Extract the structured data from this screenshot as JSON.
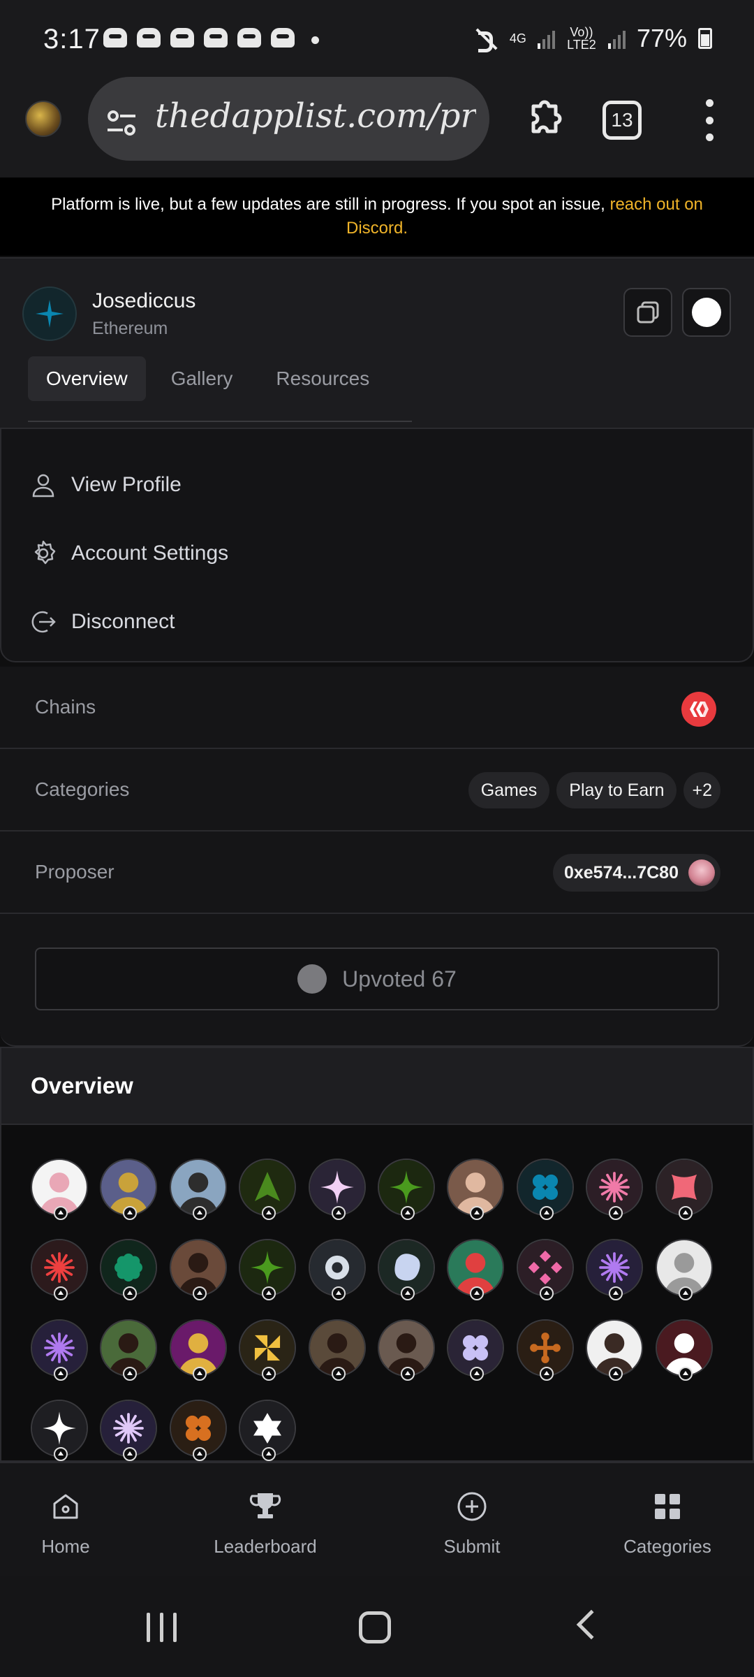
{
  "status_bar": {
    "time": "3:17",
    "network": "4G",
    "volte": "Vo)) LTE2",
    "battery": "77%"
  },
  "browser": {
    "url": "thedapplist.com/projec",
    "tab_count": "13"
  },
  "banner": {
    "text": "Platform is live, but a few updates are still in progress. If you spot an issue, ",
    "link": "reach out on Discord."
  },
  "project": {
    "name": "Josediccus",
    "chain": "Ethereum",
    "tabs": [
      "Overview",
      "Gallery",
      "Resources"
    ]
  },
  "user_menu": {
    "items": [
      "View Profile",
      "Account Settings",
      "Disconnect"
    ]
  },
  "details": {
    "chains_label": "Chains",
    "categories_label": "Categories",
    "categories": [
      "Games",
      "Play to Earn",
      "+2"
    ],
    "proposer_label": "Proposer",
    "proposer_address": "0xe574...7C80"
  },
  "upvote": {
    "label": "Upvoted 67"
  },
  "overview": {
    "title": "Overview",
    "voters": [
      {
        "bg": "#f4f4f4",
        "fg": "#e9a7b6",
        "icon": "photo"
      },
      {
        "bg": "#5b5f8a",
        "fg": "#c9a23a",
        "icon": "photo"
      },
      {
        "bg": "#8aa5c0",
        "fg": "#2d2d2d",
        "icon": "photo"
      },
      {
        "bg": "#1f2a10",
        "fg": "#4a8a1e",
        "icon": "tri"
      },
      {
        "bg": "#2a2436",
        "fg": "#f2d0f5",
        "icon": "star4"
      },
      {
        "bg": "#1c2810",
        "fg": "#4a9a1e",
        "icon": "star4"
      },
      {
        "bg": "#7a5a4a",
        "fg": "#e0b8a0",
        "icon": "photo"
      },
      {
        "bg": "#12262c",
        "fg": "#0a86b0",
        "icon": "clover"
      },
      {
        "bg": "#2c1e26",
        "fg": "#f07aa8",
        "icon": "burst"
      },
      {
        "bg": "#2c2226",
        "fg": "#f06878",
        "icon": "square"
      },
      {
        "bg": "#2c1a1c",
        "fg": "#ee4040",
        "icon": "burst"
      },
      {
        "bg": "#10261c",
        "fg": "#15966a",
        "icon": "flower"
      },
      {
        "bg": "#6a4a3a",
        "fg": "#2a1a14",
        "icon": "photo"
      },
      {
        "bg": "#1c2810",
        "fg": "#4a9a1e",
        "icon": "star4"
      },
      {
        "bg": "#262a30",
        "fg": "#d8dfe8",
        "icon": "ring"
      },
      {
        "bg": "#1c2824",
        "fg": "#c8d4f0",
        "icon": "blob"
      },
      {
        "bg": "#2a7a5a",
        "fg": "#e04040",
        "icon": "photo"
      },
      {
        "bg": "#2c1e26",
        "fg": "#f06aa8",
        "icon": "diamonds"
      },
      {
        "bg": "#26203a",
        "fg": "#b07af0",
        "icon": "burst"
      },
      {
        "bg": "#e8e8e8",
        "fg": "#9a9a9a",
        "icon": "photo"
      },
      {
        "bg": "#26203a",
        "fg": "#b07af0",
        "icon": "burst"
      },
      {
        "bg": "#4a6a3a",
        "fg": "#2a1a14",
        "icon": "photo"
      },
      {
        "bg": "#6a1a6a",
        "fg": "#e0b040",
        "icon": "photo"
      },
      {
        "bg": "#2a2416",
        "fg": "#f0c040",
        "icon": "pinwheel"
      },
      {
        "bg": "#5a4a3a",
        "fg": "#2a1a14",
        "icon": "photo"
      },
      {
        "bg": "#6a5a50",
        "fg": "#2a1a14",
        "icon": "photo"
      },
      {
        "bg": "#2a2436",
        "fg": "#c8c0f5",
        "icon": "clover"
      },
      {
        "bg": "#2a1e14",
        "fg": "#c86a20",
        "icon": "dots"
      },
      {
        "bg": "#f0f0f0",
        "fg": "#3a2a24",
        "icon": "photo"
      },
      {
        "bg": "#4a1a20",
        "fg": "#ffffff",
        "icon": "photo"
      },
      {
        "bg": "#1e1e22",
        "fg": "#ffffff",
        "icon": "star4"
      },
      {
        "bg": "#26203a",
        "fg": "#e0c8f8",
        "icon": "burst"
      },
      {
        "bg": "#2a1e14",
        "fg": "#d87020",
        "icon": "clover"
      },
      {
        "bg": "#1e1e22",
        "fg": "#ffffff",
        "icon": "star6"
      }
    ]
  },
  "bottom_nav": {
    "items": [
      "Home",
      "Leaderboard",
      "Submit",
      "Categories"
    ]
  },
  "colors": {
    "accent_link": "#f0b429",
    "chain_icon": "#e83a3e"
  }
}
